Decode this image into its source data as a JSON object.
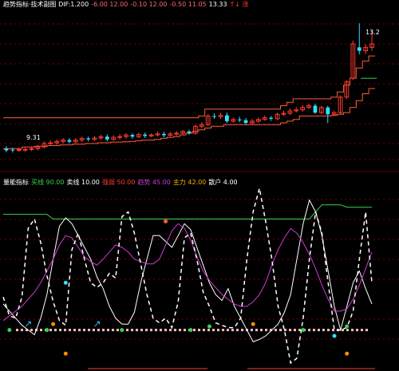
{
  "colors": {
    "background": "#000000",
    "grid": "#7a0000",
    "up": "#ff3b30",
    "down": "#33e0ff",
    "header_white": "#ffffff",
    "green": "#39d353",
    "white_line": "#ffffff",
    "magenta_line": "#d03ad0",
    "dashed_line": "#ffffff",
    "zero_band": "#ffc0c0",
    "channel": "#ff5a3c"
  },
  "price_panel": {
    "header": [
      {
        "text": "趋势指标·技术副图 DIF:1.200",
        "color": "#ffffff"
      },
      {
        "text": "-6.00 12.00",
        "color": "#ff6a6a"
      },
      {
        "text": "-0.10 12.00",
        "color": "#ff6a6a"
      },
      {
        "text": "-0.50 11.05",
        "color": "#ff6a6a"
      },
      {
        "text": "13.33",
        "color": "#ffffff"
      },
      {
        "text": "↑↓ 涨",
        "color": "#ff3b30"
      }
    ],
    "price_labels": [
      {
        "text": "13.2",
        "color": "#ffffff"
      },
      {
        "text": "9.31",
        "color": "#ffffff"
      }
    ]
  },
  "indicator_panel": {
    "header": [
      {
        "text": "量能指标",
        "color": "#ffffff"
      },
      {
        "text": "买线 90.00",
        "color": "#39d353"
      },
      {
        "text": "卖线 10.00",
        "color": "#ffffff"
      },
      {
        "text": "强弱 50.00",
        "color": "#ff3b30"
      },
      {
        "text": "趋势 45.00",
        "color": "#d03ad0"
      },
      {
        "text": "主力 42.00",
        "color": "#ffb000"
      },
      {
        "text": "散户 4.00",
        "color": "#ffffff"
      }
    ]
  },
  "chart_data": [
    {
      "type": "candlestick",
      "title": "",
      "ylim": [
        9.0,
        13.6
      ],
      "candles": [
        [
          9.55,
          9.5,
          9.62,
          9.45
        ],
        [
          9.52,
          9.5,
          9.58,
          9.44
        ],
        [
          9.5,
          9.52,
          9.58,
          9.46
        ],
        [
          9.51,
          9.53,
          9.6,
          9.45
        ],
        [
          9.53,
          9.55,
          9.62,
          9.48
        ],
        [
          9.55,
          9.6,
          9.66,
          9.5
        ],
        [
          9.6,
          9.7,
          9.76,
          9.56
        ],
        [
          9.7,
          9.72,
          9.8,
          9.64
        ],
        [
          9.72,
          9.76,
          9.82,
          9.66
        ],
        [
          9.76,
          9.8,
          9.86,
          9.7
        ],
        [
          9.8,
          9.75,
          9.86,
          9.7
        ],
        [
          9.75,
          9.8,
          9.86,
          9.7
        ],
        [
          9.8,
          9.85,
          9.9,
          9.74
        ],
        [
          9.85,
          9.82,
          9.9,
          9.76
        ],
        [
          9.82,
          9.86,
          9.92,
          9.78
        ],
        [
          9.86,
          9.9,
          9.96,
          9.8
        ],
        [
          9.9,
          9.82,
          9.96,
          9.76
        ],
        [
          9.82,
          9.88,
          9.94,
          9.78
        ],
        [
          9.88,
          9.9,
          9.98,
          9.82
        ],
        [
          9.9,
          9.95,
          10.0,
          9.84
        ],
        [
          9.95,
          9.9,
          10.0,
          9.84
        ],
        [
          9.9,
          9.96,
          10.02,
          9.86
        ],
        [
          9.96,
          9.92,
          10.02,
          9.86
        ],
        [
          9.92,
          9.95,
          10.0,
          9.88
        ],
        [
          9.95,
          9.98,
          10.05,
          9.9
        ],
        [
          9.98,
          9.94,
          10.04,
          9.88
        ],
        [
          9.94,
          9.98,
          10.04,
          9.9
        ],
        [
          9.98,
          10.0,
          10.06,
          9.92
        ],
        [
          10.0,
          10.05,
          10.1,
          9.95
        ],
        [
          10.05,
          10.0,
          10.1,
          9.95
        ],
        [
          10.0,
          10.2,
          10.26,
          9.96
        ],
        [
          10.2,
          10.25,
          10.32,
          10.15
        ],
        [
          10.25,
          10.5,
          10.56,
          10.2
        ],
        [
          10.5,
          10.48,
          10.58,
          10.42
        ],
        [
          10.48,
          10.52,
          10.6,
          10.42
        ],
        [
          10.52,
          10.35,
          10.6,
          10.3
        ],
        [
          10.35,
          10.4,
          10.46,
          10.3
        ],
        [
          10.4,
          10.38,
          10.48,
          10.32
        ],
        [
          10.38,
          10.3,
          10.44,
          10.24
        ],
        [
          10.3,
          10.35,
          10.42,
          10.26
        ],
        [
          10.35,
          10.4,
          10.46,
          10.3
        ],
        [
          10.4,
          10.45,
          10.52,
          10.36
        ],
        [
          10.45,
          10.42,
          10.5,
          10.36
        ],
        [
          10.42,
          10.55,
          10.6,
          10.38
        ],
        [
          10.55,
          10.58,
          10.66,
          10.5
        ],
        [
          10.58,
          10.65,
          10.72,
          10.52
        ],
        [
          10.65,
          10.68,
          10.76,
          10.6
        ],
        [
          10.68,
          10.75,
          10.82,
          10.62
        ],
        [
          10.75,
          10.8,
          10.86,
          10.7
        ],
        [
          10.8,
          10.6,
          10.86,
          10.56
        ],
        [
          10.6,
          10.75,
          10.8,
          10.55
        ],
        [
          10.75,
          10.55,
          10.8,
          10.3
        ],
        [
          10.55,
          10.6,
          10.66,
          10.5
        ],
        [
          10.6,
          11.05,
          11.1,
          10.55
        ],
        [
          11.05,
          11.5,
          11.55,
          11.0
        ],
        [
          11.6,
          12.6,
          12.7,
          11.55
        ],
        [
          12.5,
          12.4,
          13.2,
          12.3
        ],
        [
          12.4,
          12.5,
          12.6,
          12.3
        ],
        [
          12.5,
          12.6,
          13.0,
          12.4
        ]
      ],
      "channel_upper": [
        10.45,
        10.45,
        10.45,
        10.45,
        10.45,
        10.45,
        10.45,
        10.45,
        10.45,
        10.45,
        10.45,
        10.45,
        10.45,
        10.45,
        10.45,
        10.45,
        10.45,
        10.45,
        10.45,
        10.45,
        10.45,
        10.45,
        10.45,
        10.45,
        10.45,
        10.45,
        10.45,
        10.45,
        10.45,
        10.45,
        10.45,
        10.5,
        10.7,
        10.7,
        10.7,
        10.7,
        10.7,
        10.7,
        10.7,
        10.7,
        10.7,
        10.7,
        10.7,
        10.7,
        10.8,
        10.9,
        11.0,
        11.0,
        11.0,
        11.0,
        11.0,
        11.0,
        11.05,
        11.2,
        11.4,
        11.6,
        11.9,
        12.1,
        12.25
      ],
      "channel_lower": [
        9.55,
        9.55,
        9.55,
        9.6,
        9.6,
        9.62,
        9.62,
        9.64,
        9.64,
        9.66,
        9.66,
        9.68,
        9.68,
        9.7,
        9.7,
        9.72,
        9.72,
        9.74,
        9.74,
        9.75,
        9.76,
        9.78,
        9.8,
        9.8,
        9.82,
        9.85,
        9.88,
        9.9,
        9.95,
        10.0,
        10.05,
        10.1,
        10.15,
        10.2,
        10.2,
        10.25,
        10.25,
        10.25,
        10.25,
        10.25,
        10.25,
        10.25,
        10.25,
        10.25,
        10.3,
        10.35,
        10.4,
        10.5,
        10.5,
        10.5,
        10.5,
        10.5,
        10.52,
        10.55,
        10.6,
        10.75,
        10.95,
        11.15,
        11.3
      ]
    },
    {
      "type": "line",
      "title": "",
      "ylim": [
        -30,
        120
      ],
      "x_count": 60,
      "series": [
        {
          "name": "买线",
          "color": "#39d353",
          "values": [
            98,
            98,
            98,
            98,
            98,
            98,
            98,
            98,
            94,
            94,
            94,
            94,
            94,
            94,
            94,
            94,
            94,
            94,
            94,
            94,
            94,
            94,
            94,
            94,
            94,
            94,
            94,
            94,
            94,
            94,
            94,
            94,
            94,
            94,
            94,
            94,
            94,
            94,
            94,
            94,
            94,
            94,
            94,
            94,
            94,
            94,
            94,
            94,
            94,
            94,
            100,
            106,
            106,
            106,
            106,
            104,
            104,
            104,
            104,
            104
          ]
        },
        {
          "name": "卖线",
          "color": "#ffffff",
          "values": [
            22,
            16,
            10,
            4,
            0,
            -4,
            10,
            30,
            60,
            88,
            95,
            90,
            80,
            70,
            60,
            45,
            35,
            20,
            10,
            5,
            5,
            15,
            40,
            60,
            80,
            80,
            75,
            70,
            80,
            90,
            85,
            70,
            55,
            40,
            30,
            25,
            35,
            20,
            10,
            0,
            -10,
            -8,
            -5,
            0,
            5,
            15,
            30,
            60,
            90,
            110,
            100,
            80,
            50,
            20,
            0,
            20,
            40,
            50,
            35,
            22
          ]
        },
        {
          "name": "趋势",
          "color": "#d03ad0",
          "values": [
            8,
            12,
            16,
            20,
            26,
            32,
            40,
            50,
            60,
            72,
            80,
            78,
            70,
            62,
            58,
            55,
            60,
            66,
            72,
            70,
            66,
            60,
            58,
            56,
            56,
            60,
            72,
            84,
            90,
            86,
            76,
            62,
            50,
            42,
            36,
            30,
            26,
            22,
            20,
            20,
            24,
            30,
            40,
            55,
            68,
            78,
            86,
            82,
            74,
            64,
            52,
            38,
            26,
            16,
            16,
            18,
            26,
            38,
            52,
            66
          ]
        },
        {
          "name": "强弱",
          "color": "#ffffff",
          "dashed": true,
          "values": [
            28,
            12,
            10,
            28,
            86,
            94,
            74,
            46,
            24,
            8,
            4,
            68,
            82,
            60,
            40,
            36,
            40,
            48,
            44,
            96,
            100,
            82,
            56,
            30,
            10,
            6,
            10,
            2,
            24,
            78,
            82,
            60,
            32,
            20,
            6,
            4,
            2,
            2,
            10,
            60,
            100,
            120,
            92,
            60,
            20,
            0,
            -28,
            -24,
            10,
            60,
            100,
            82,
            40,
            0,
            0,
            2,
            16,
            60,
            100,
            40
          ]
        }
      ]
    }
  ]
}
